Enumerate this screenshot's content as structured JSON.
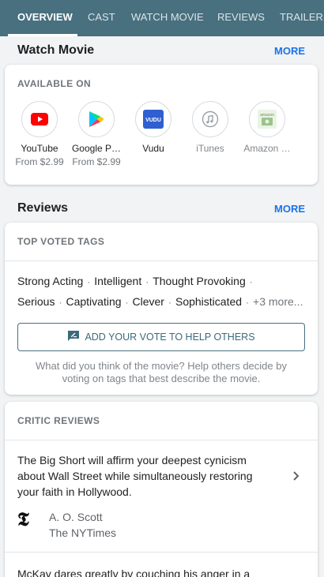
{
  "tabs": [
    "OVERVIEW",
    "CAST",
    "WATCH MOVIE",
    "REVIEWS",
    "TRAILERS"
  ],
  "watch": {
    "title": "Watch Movie",
    "more": "MORE",
    "available_label": "AVAILABLE ON",
    "providers": [
      {
        "name": "YouTube",
        "price": "From $2.99",
        "icon": "youtube-icon"
      },
      {
        "name": "Google P…",
        "price": "From $2.99",
        "icon": "google-play-icon"
      },
      {
        "name": "Vudu",
        "price": "",
        "icon": "vudu-icon",
        "icon_text": "VUDU"
      },
      {
        "name": "iTunes",
        "price": "",
        "icon": "itunes-icon"
      },
      {
        "name": "Amazon …",
        "price": "",
        "icon": "amazon-icon",
        "icon_text": "amazon"
      }
    ]
  },
  "reviews": {
    "title": "Reviews",
    "more": "MORE",
    "top_tags_label": "TOP VOTED TAGS",
    "tags": [
      "Strong Acting",
      "Intelligent",
      "Thought Provoking",
      "Serious",
      "Captivating",
      "Clever",
      "Sophisticated"
    ],
    "more_tags": "+3 more...",
    "vote_button": "ADD YOUR VOTE TO HELP OTHERS",
    "vote_help": "What did you think of the movie? Help others decide by voting on tags that best describe the movie."
  },
  "critics": {
    "label": "CRITIC REVIEWS",
    "items": [
      {
        "text": "The Big Short will affirm your deepest cynicism about Wall Street while simultaneously restoring your faith in Hollywood.",
        "author": "A. O. Scott",
        "publication": "The NYTimes",
        "logo": "𝕿"
      },
      {
        "text": "McKay dares greatly by couching his anger in a"
      }
    ]
  },
  "colors": {
    "tab_bar": "#48707f",
    "link": "#1a73e8",
    "youtube": "#ff0000"
  }
}
